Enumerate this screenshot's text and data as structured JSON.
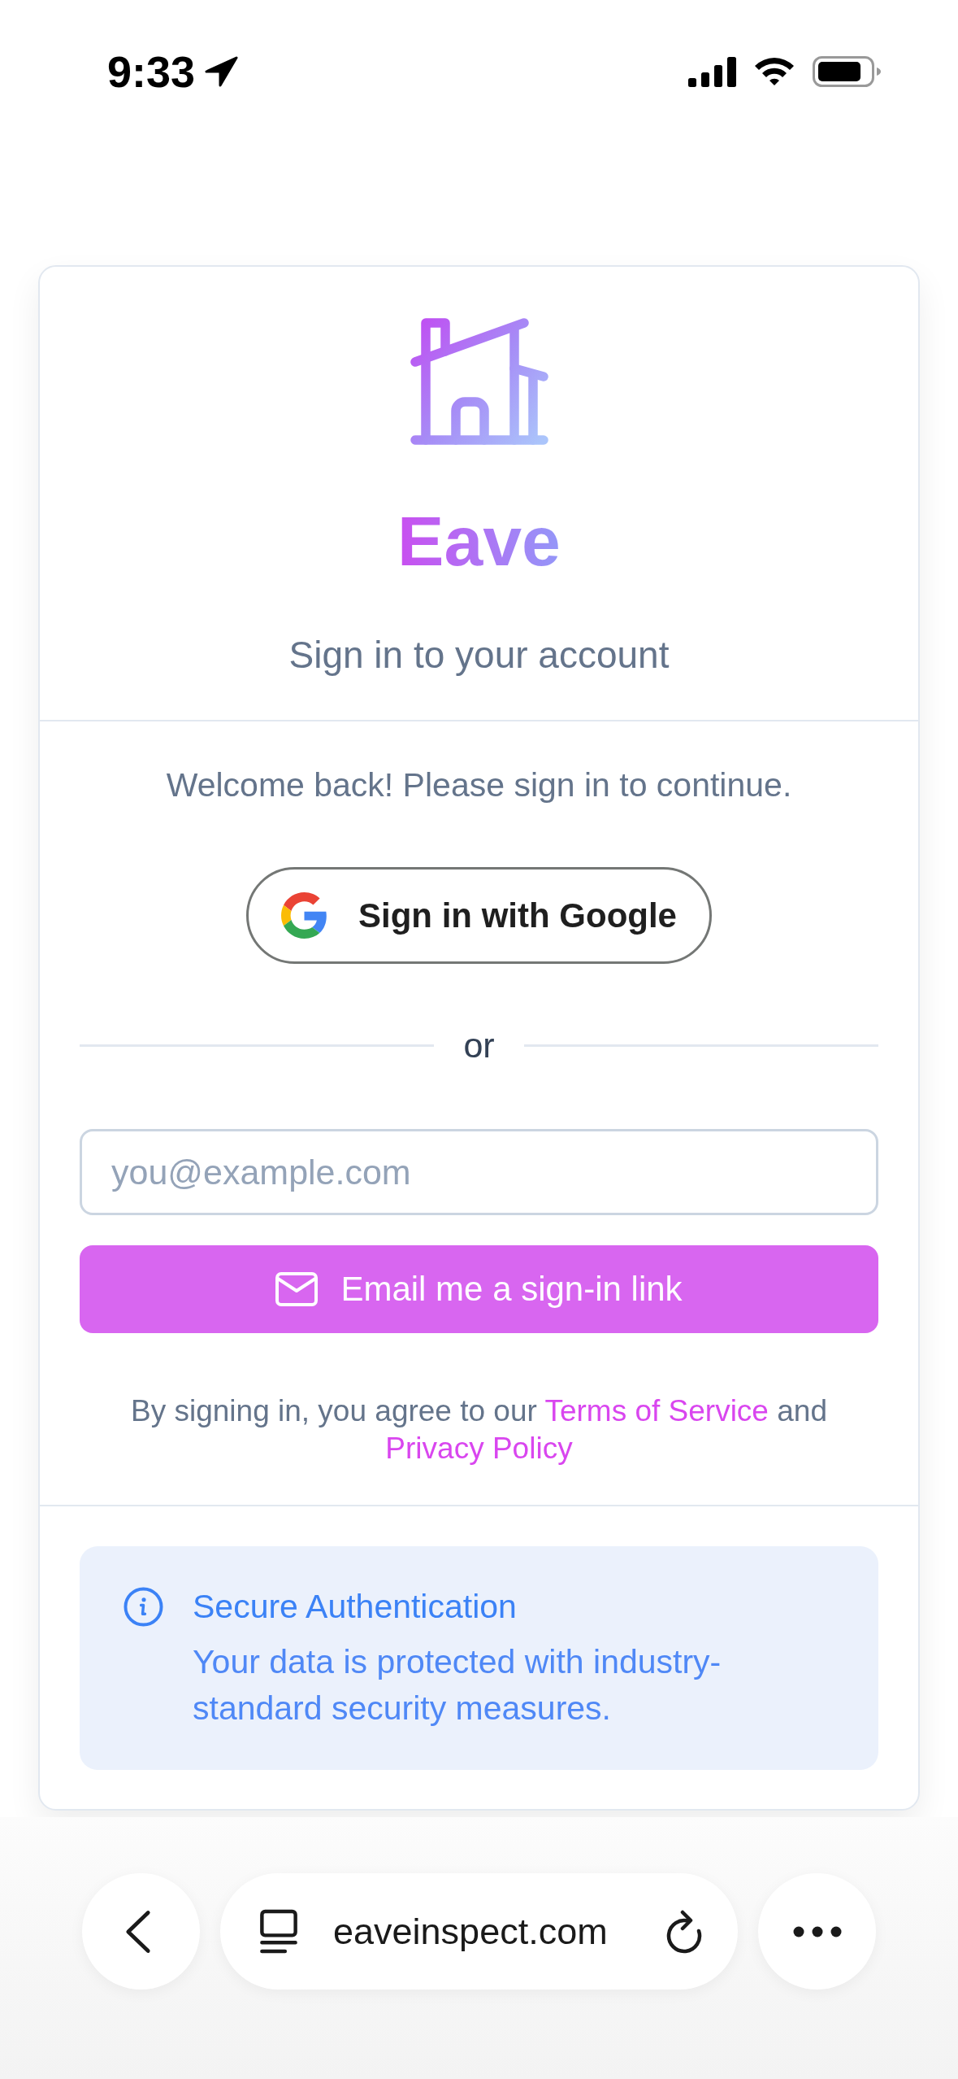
{
  "status_bar": {
    "time": "9:33"
  },
  "brand": {
    "name": "Eave",
    "subtitle": "Sign in to your account"
  },
  "sign_in": {
    "welcome": "Welcome back! Please sign in to continue.",
    "google_button": "Sign in with Google",
    "divider": "or",
    "email_field": {
      "placeholder": "you@example.com"
    },
    "email_button": "Email me a sign-in link",
    "terms": {
      "prefix": "By signing in, you agree to our",
      "terms_link": "Terms of Service",
      "middle": "and",
      "privacy_link": "Privacy Policy"
    }
  },
  "notice": {
    "title": "Secure Authentication",
    "text": "Your data is protected with industry-standard security measures."
  },
  "browser_bar": {
    "url": "eaveinspect.com"
  }
}
